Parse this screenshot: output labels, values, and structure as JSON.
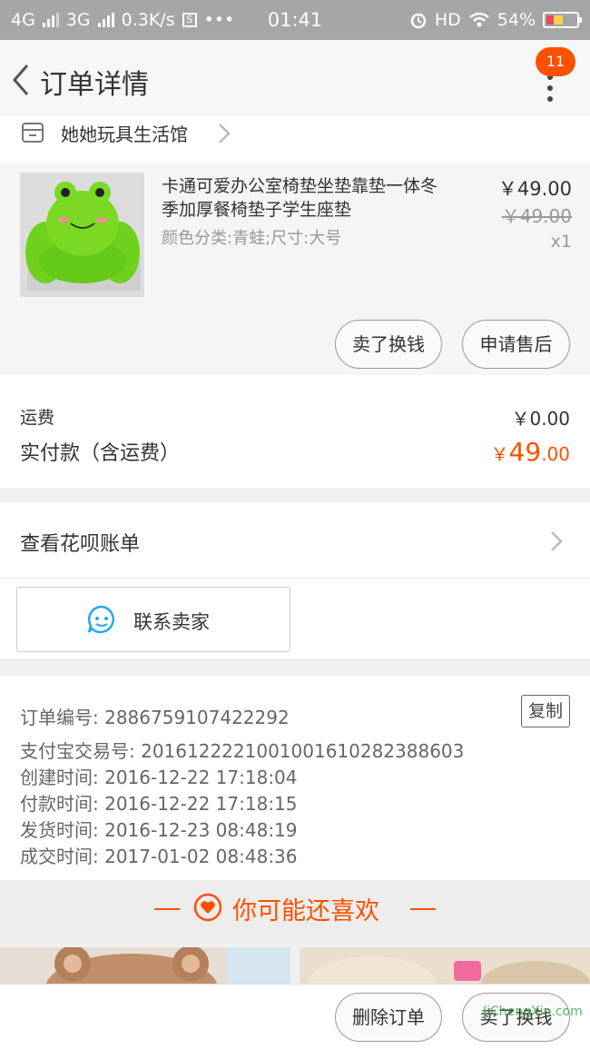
{
  "status_bar": {
    "net1": "4G",
    "net2": "3G",
    "speed": "0.3K/s",
    "s_icon": "S",
    "dots": "•••",
    "time": "01:41",
    "hd": "HD",
    "battery": "54%"
  },
  "header": {
    "title": "订单详情",
    "badge": "11"
  },
  "shop": {
    "name": "她她玩具生活馆"
  },
  "product": {
    "name": "卡通可爱办公室椅垫坐垫靠垫一体冬季加厚餐椅垫子学生座垫",
    "attributes": "颜色分类:青蛙;尺寸:大号",
    "price": "￥49.00",
    "original_price": "￥49.00",
    "quantity": "x1",
    "sell_button": "卖了换钱",
    "aftersale_button": "申请售后"
  },
  "fees": {
    "shipping_label": "运费",
    "shipping_value": "￥0.00",
    "paid_label": "实付款（含运费）",
    "paid_currency": "￥",
    "paid_int": "49",
    "paid_dec": ".00"
  },
  "huabei": {
    "label": "查看花呗账单"
  },
  "contact": {
    "label": "联系卖家"
  },
  "order_info": {
    "order_no": "订单编号: 2886759107422292",
    "copy": "复制",
    "alipay_no": "支付宝交易号: 2016122221001001610282388603",
    "created": "创建时间: 2016-12-22 17:18:04",
    "paid": "付款时间: 2016-12-22 17:18:15",
    "shipped": "发货时间: 2016-12-23 08:48:19",
    "completed": "成交时间: 2017-01-02 08:48:36"
  },
  "recommend": {
    "label": "你可能还喜欢"
  },
  "bottom": {
    "delete_button": "删除订单",
    "sell_button": "卖了换钱"
  },
  "watermark": "JiChengXin.com",
  "colors": {
    "accent": "#ff5000",
    "status_bar": "#a6a6a6"
  }
}
